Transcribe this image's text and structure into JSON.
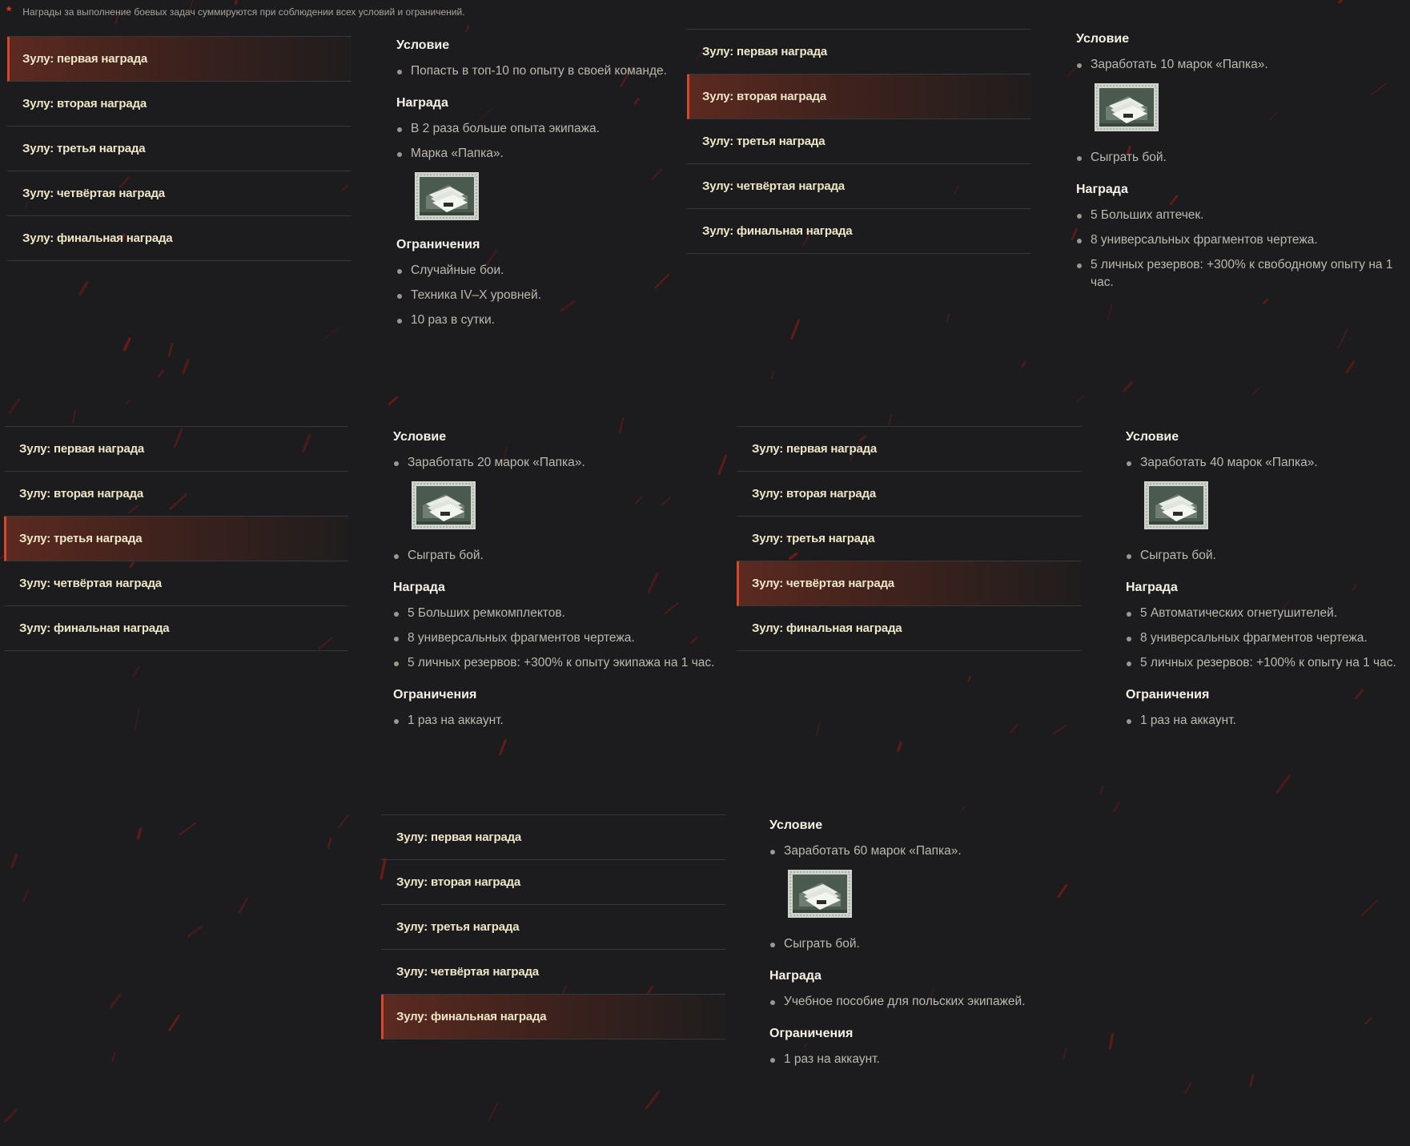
{
  "note": "Награды за выполнение боевых задач суммируются при соблюдении всех условий и ограничений.",
  "tab_labels": [
    "Зулу: первая награда",
    "Зулу: вторая награда",
    "Зулу: третья награда",
    "Зулу: четвёртая награда",
    "Зулу: финальная награда"
  ],
  "headings": {
    "condition": "Условие",
    "reward": "Награда",
    "restrictions": "Ограничения"
  },
  "stamp_icon": "papka-stamp-icon",
  "colors": {
    "background": "#1c1c1e",
    "accent": "#d9442a",
    "tab_text": "#efe6c8"
  },
  "panels": [
    {
      "active_tab": 0,
      "conditions": [
        "Попасть в топ-10 по опыту в своей команде."
      ],
      "rewards": [
        "В 2 раза больше опыта экипажа.",
        "Марка «Папка»."
      ],
      "restrictions": [
        "Случайные бои.",
        "Техника IV–X уровней.",
        "10 раз в сутки."
      ]
    },
    {
      "active_tab": 1,
      "conditions": [
        "Заработать 10 марок «Папка».",
        "Сыграть бой."
      ],
      "rewards": [
        "5 Больших аптечек.",
        "8 универсальных фрагментов чертежа.",
        "5 личных резервов: +300% к свободному опыту на 1 час."
      ],
      "restrictions": []
    },
    {
      "active_tab": 2,
      "conditions": [
        "Заработать 20 марок «Папка».",
        "Сыграть бой."
      ],
      "rewards": [
        "5 Больших ремкомплектов.",
        "8 универсальных фрагментов чертежа.",
        "5 личных резервов: +300% к опыту экипажа на 1 час."
      ],
      "restrictions": [
        "1 раз на аккаунт."
      ]
    },
    {
      "active_tab": 3,
      "conditions": [
        "Заработать 40 марок «Папка».",
        "Сыграть бой."
      ],
      "rewards": [
        "5 Автоматических огнетушителей.",
        "8 универсальных фрагментов чертежа.",
        "5 личных резервов: +100% к опыту на 1 час."
      ],
      "restrictions": [
        "1 раз на аккаунт."
      ]
    },
    {
      "active_tab": 4,
      "conditions": [
        "Заработать 60 марок «Папка».",
        "Сыграть бой."
      ],
      "rewards": [
        "Учебное пособие для польских экипажей."
      ],
      "restrictions": [
        "1 раз на аккаунт."
      ]
    }
  ]
}
